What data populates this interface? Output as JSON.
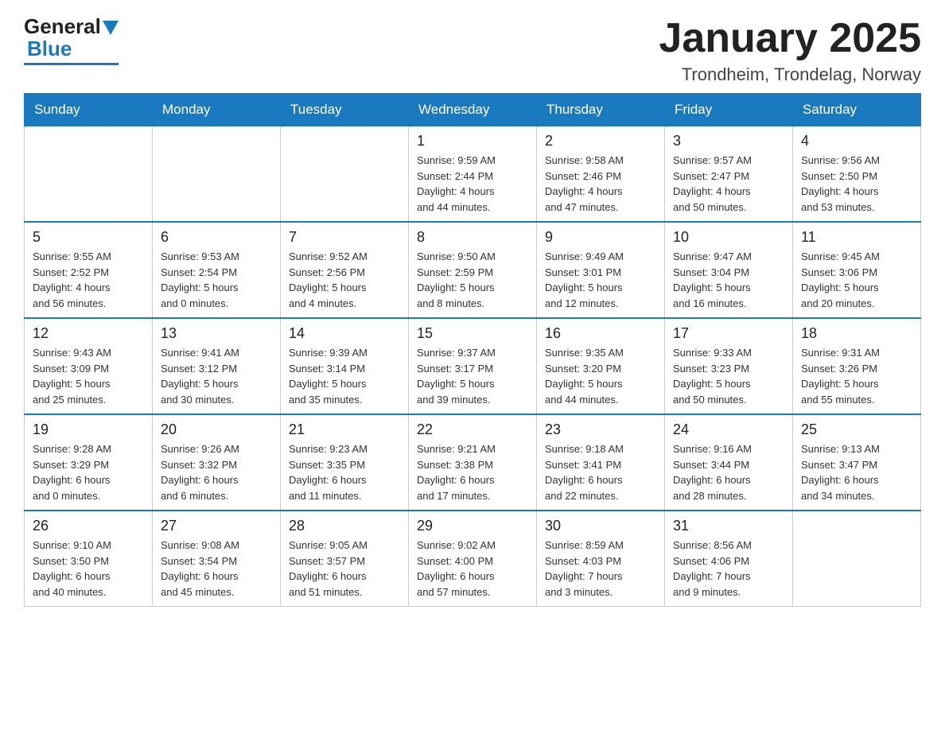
{
  "header": {
    "logo_general": "General",
    "logo_blue": "Blue",
    "month_title": "January 2025",
    "location": "Trondheim, Trondelag, Norway"
  },
  "weekdays": [
    "Sunday",
    "Monday",
    "Tuesday",
    "Wednesday",
    "Thursday",
    "Friday",
    "Saturday"
  ],
  "weeks": [
    [
      {
        "day": "",
        "info": ""
      },
      {
        "day": "",
        "info": ""
      },
      {
        "day": "",
        "info": ""
      },
      {
        "day": "1",
        "info": "Sunrise: 9:59 AM\nSunset: 2:44 PM\nDaylight: 4 hours\nand 44 minutes."
      },
      {
        "day": "2",
        "info": "Sunrise: 9:58 AM\nSunset: 2:46 PM\nDaylight: 4 hours\nand 47 minutes."
      },
      {
        "day": "3",
        "info": "Sunrise: 9:57 AM\nSunset: 2:47 PM\nDaylight: 4 hours\nand 50 minutes."
      },
      {
        "day": "4",
        "info": "Sunrise: 9:56 AM\nSunset: 2:50 PM\nDaylight: 4 hours\nand 53 minutes."
      }
    ],
    [
      {
        "day": "5",
        "info": "Sunrise: 9:55 AM\nSunset: 2:52 PM\nDaylight: 4 hours\nand 56 minutes."
      },
      {
        "day": "6",
        "info": "Sunrise: 9:53 AM\nSunset: 2:54 PM\nDaylight: 5 hours\nand 0 minutes."
      },
      {
        "day": "7",
        "info": "Sunrise: 9:52 AM\nSunset: 2:56 PM\nDaylight: 5 hours\nand 4 minutes."
      },
      {
        "day": "8",
        "info": "Sunrise: 9:50 AM\nSunset: 2:59 PM\nDaylight: 5 hours\nand 8 minutes."
      },
      {
        "day": "9",
        "info": "Sunrise: 9:49 AM\nSunset: 3:01 PM\nDaylight: 5 hours\nand 12 minutes."
      },
      {
        "day": "10",
        "info": "Sunrise: 9:47 AM\nSunset: 3:04 PM\nDaylight: 5 hours\nand 16 minutes."
      },
      {
        "day": "11",
        "info": "Sunrise: 9:45 AM\nSunset: 3:06 PM\nDaylight: 5 hours\nand 20 minutes."
      }
    ],
    [
      {
        "day": "12",
        "info": "Sunrise: 9:43 AM\nSunset: 3:09 PM\nDaylight: 5 hours\nand 25 minutes."
      },
      {
        "day": "13",
        "info": "Sunrise: 9:41 AM\nSunset: 3:12 PM\nDaylight: 5 hours\nand 30 minutes."
      },
      {
        "day": "14",
        "info": "Sunrise: 9:39 AM\nSunset: 3:14 PM\nDaylight: 5 hours\nand 35 minutes."
      },
      {
        "day": "15",
        "info": "Sunrise: 9:37 AM\nSunset: 3:17 PM\nDaylight: 5 hours\nand 39 minutes."
      },
      {
        "day": "16",
        "info": "Sunrise: 9:35 AM\nSunset: 3:20 PM\nDaylight: 5 hours\nand 44 minutes."
      },
      {
        "day": "17",
        "info": "Sunrise: 9:33 AM\nSunset: 3:23 PM\nDaylight: 5 hours\nand 50 minutes."
      },
      {
        "day": "18",
        "info": "Sunrise: 9:31 AM\nSunset: 3:26 PM\nDaylight: 5 hours\nand 55 minutes."
      }
    ],
    [
      {
        "day": "19",
        "info": "Sunrise: 9:28 AM\nSunset: 3:29 PM\nDaylight: 6 hours\nand 0 minutes."
      },
      {
        "day": "20",
        "info": "Sunrise: 9:26 AM\nSunset: 3:32 PM\nDaylight: 6 hours\nand 6 minutes."
      },
      {
        "day": "21",
        "info": "Sunrise: 9:23 AM\nSunset: 3:35 PM\nDaylight: 6 hours\nand 11 minutes."
      },
      {
        "day": "22",
        "info": "Sunrise: 9:21 AM\nSunset: 3:38 PM\nDaylight: 6 hours\nand 17 minutes."
      },
      {
        "day": "23",
        "info": "Sunrise: 9:18 AM\nSunset: 3:41 PM\nDaylight: 6 hours\nand 22 minutes."
      },
      {
        "day": "24",
        "info": "Sunrise: 9:16 AM\nSunset: 3:44 PM\nDaylight: 6 hours\nand 28 minutes."
      },
      {
        "day": "25",
        "info": "Sunrise: 9:13 AM\nSunset: 3:47 PM\nDaylight: 6 hours\nand 34 minutes."
      }
    ],
    [
      {
        "day": "26",
        "info": "Sunrise: 9:10 AM\nSunset: 3:50 PM\nDaylight: 6 hours\nand 40 minutes."
      },
      {
        "day": "27",
        "info": "Sunrise: 9:08 AM\nSunset: 3:54 PM\nDaylight: 6 hours\nand 45 minutes."
      },
      {
        "day": "28",
        "info": "Sunrise: 9:05 AM\nSunset: 3:57 PM\nDaylight: 6 hours\nand 51 minutes."
      },
      {
        "day": "29",
        "info": "Sunrise: 9:02 AM\nSunset: 4:00 PM\nDaylight: 6 hours\nand 57 minutes."
      },
      {
        "day": "30",
        "info": "Sunrise: 8:59 AM\nSunset: 4:03 PM\nDaylight: 7 hours\nand 3 minutes."
      },
      {
        "day": "31",
        "info": "Sunrise: 8:56 AM\nSunset: 4:06 PM\nDaylight: 7 hours\nand 9 minutes."
      },
      {
        "day": "",
        "info": ""
      }
    ]
  ]
}
